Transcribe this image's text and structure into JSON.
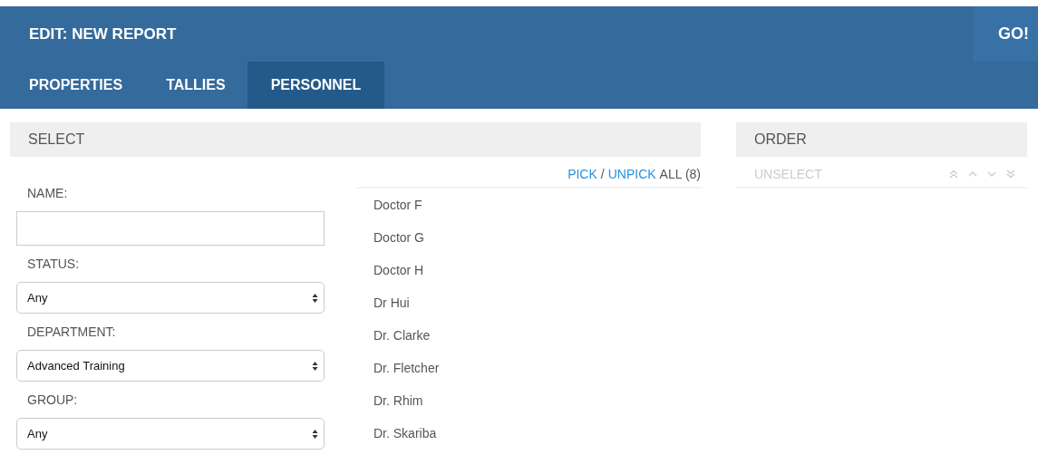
{
  "header": {
    "title": "EDIT: NEW REPORT",
    "go_button": "GO!"
  },
  "tabs": [
    {
      "label": "PROPERTIES",
      "selected": false
    },
    {
      "label": "TALLIES",
      "selected": false
    },
    {
      "label": "PERSONNEL",
      "selected": true
    }
  ],
  "select_panel": {
    "title": "SELECT",
    "filters": [
      {
        "kind": "text",
        "label": "NAME:"
      },
      {
        "kind": "dropdown",
        "label": "STATUS:",
        "value": "Any"
      },
      {
        "kind": "dropdown",
        "label": "DEPARTMENT:",
        "value": "Advanced Training"
      },
      {
        "kind": "dropdown",
        "label": "GROUP:",
        "value": "Any"
      }
    ],
    "pick_link": "PICK",
    "separator": "/",
    "unpick_link": "UNPICK",
    "all_count": "ALL (8)",
    "people": [
      "Doctor F",
      "Doctor G",
      "Doctor H",
      "Dr Hui",
      "Dr. Clarke",
      "Dr. Fletcher",
      "Dr. Rhim",
      "Dr. Skariba"
    ]
  },
  "order_panel": {
    "title": "ORDER",
    "unselect": {
      "label": "UNSELECT",
      "disabled": true
    }
  }
}
